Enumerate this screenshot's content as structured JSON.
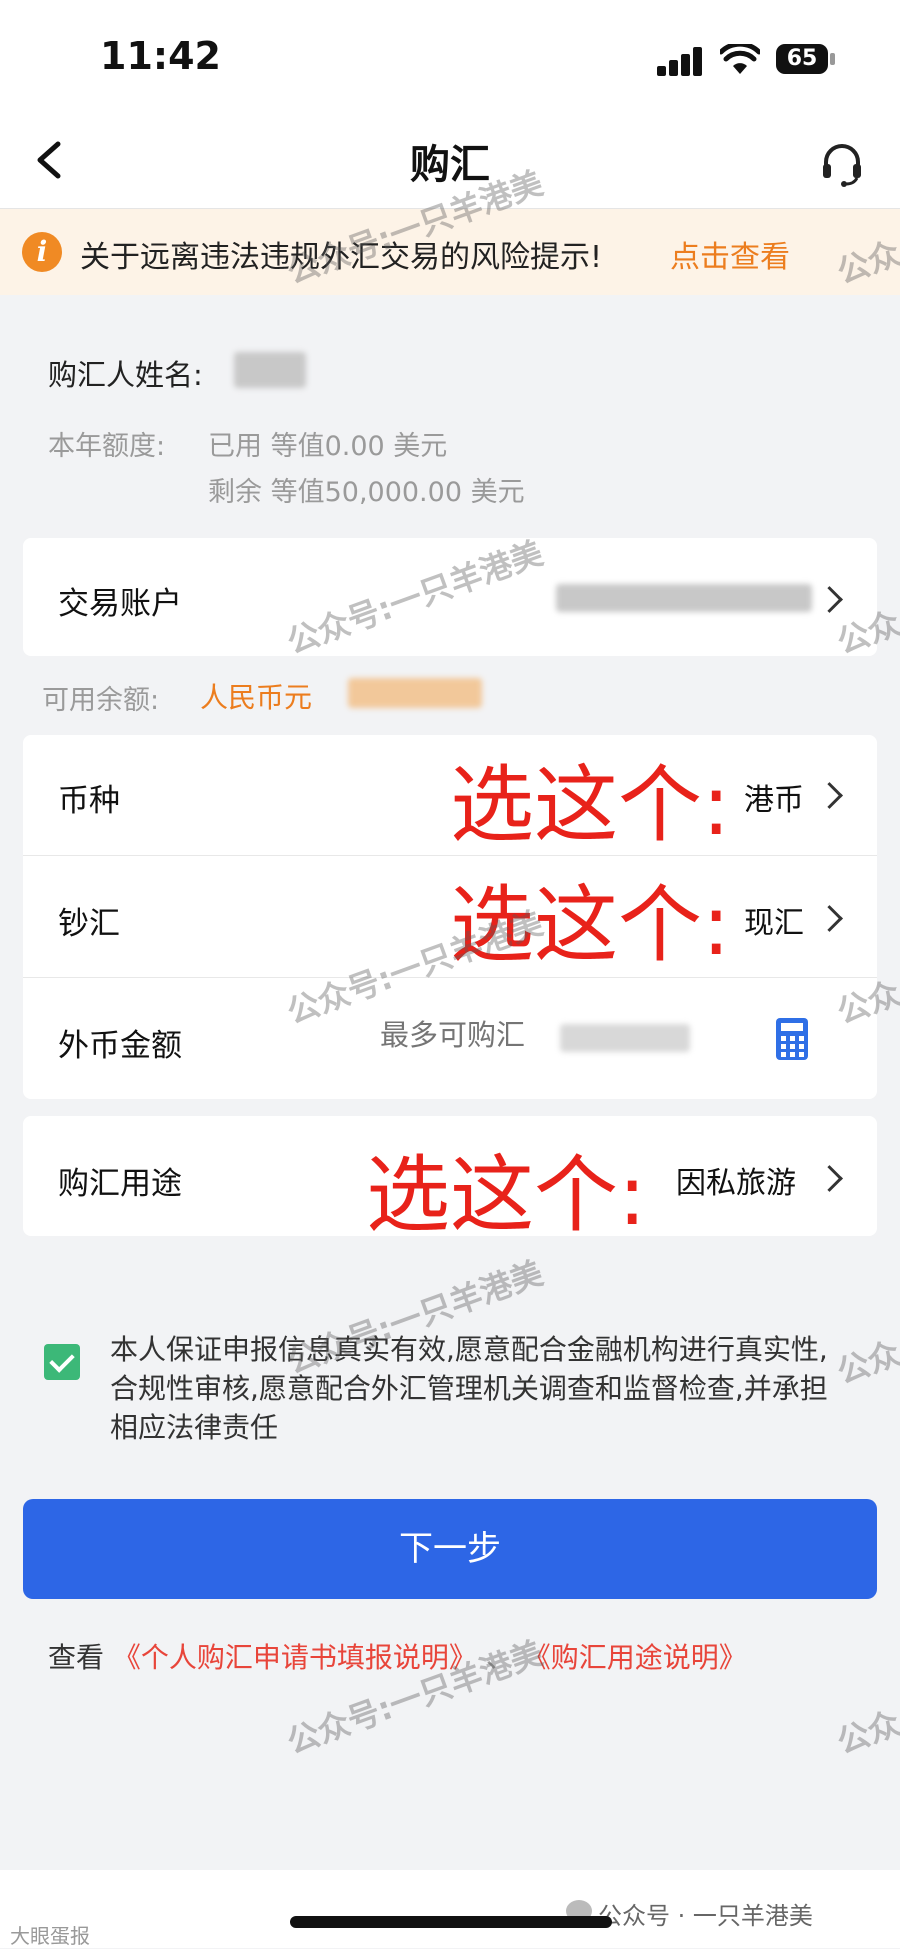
{
  "status_bar": {
    "time": "11:42",
    "battery": "65"
  },
  "nav": {
    "title": "购汇"
  },
  "notice": {
    "text": "关于远离违法违规外汇交易的风险提示!",
    "link": "点击查看"
  },
  "buyer": {
    "name_label": "购汇人姓名:",
    "quota_label": "本年额度:",
    "quota_used": "已用 等值0.00 美元",
    "quota_remaining": "剩余 等值50,000.00 美元"
  },
  "account": {
    "label": "交易账户",
    "available_label": "可用余额:",
    "available_currency": "人民币元"
  },
  "form": {
    "currency": {
      "label": "币种",
      "value": "港币"
    },
    "cash_type": {
      "label": "钞汇",
      "value": "现汇"
    },
    "amount": {
      "label": "外币金额",
      "placeholder": "最多可购汇"
    },
    "purpose": {
      "label": "购汇用途",
      "value": "因私旅游"
    }
  },
  "annotation": "选这个:",
  "declaration": {
    "checked": true,
    "text": "本人保证申报信息真实有效,愿意配合金融机构进行真实性,合规性审核,愿意配合外汇管理机关调查和监督检查,并承担相应法律责任"
  },
  "next_button": "下一步",
  "links": {
    "prefix": "查看",
    "guide": "《个人购汇申请书填报说明》",
    "separator": "、",
    "purpose_desc": "《购汇用途说明》"
  },
  "watermark": {
    "text": "公众号:一只羊港美",
    "short": "公众",
    "bottom": "公众号 · 一只羊港美",
    "corner": "大眼蛋报"
  },
  "colors": {
    "primary": "#2d66e6",
    "accent_orange": "#ec7d1e",
    "annotation_red": "#e8221a",
    "check_green": "#3cb878"
  }
}
